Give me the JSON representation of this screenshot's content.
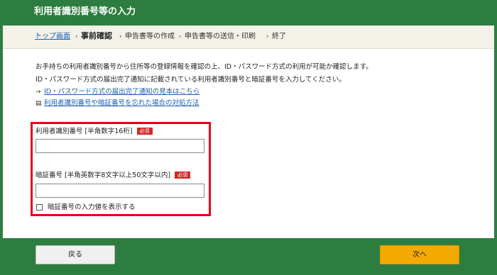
{
  "window": {
    "title": "利用者識別番号等の入力"
  },
  "breadcrumb": {
    "home": "トップ画面",
    "sep": "›",
    "current": "事前確認",
    "step3": "申告書等の作成",
    "step4": "申告書等の送信・印刷",
    "step5": "終了"
  },
  "intro": {
    "line1": "お手持ちの利用者識別番号から住所等の登録情報を確認の上、ID・パスワード方式の利用が可能か確認します。",
    "line2": "ID・パスワード方式の届出完了通知に記載されている利用者識別番号と暗証番号を入力してください。"
  },
  "links": {
    "sample": {
      "icon": "→",
      "label": "ID・パスワード方式の届出完了通知の見本はこちら"
    },
    "forgot": {
      "icon": "▤",
      "label": "利用者識別番号や暗証番号を忘れた場合の対処方法"
    }
  },
  "form": {
    "user_id": {
      "label": "利用者識別番号 [半角数字16桁]",
      "required": "必須",
      "value": ""
    },
    "password": {
      "label": "暗証番号 [半角英数字8文字以上50文字以内]",
      "required": "必須",
      "value": ""
    },
    "show_password": {
      "label": "暗証番号の入力値を表示する",
      "checked": false
    }
  },
  "footer": {
    "back_label": "戻る",
    "next_label": "次へ"
  },
  "colors": {
    "header_green": "#2e7d40",
    "highlight_red": "#e4001b",
    "next_orange": "#f3aa00",
    "required_red": "#d12828",
    "link_blue": "#1a5fb4"
  }
}
